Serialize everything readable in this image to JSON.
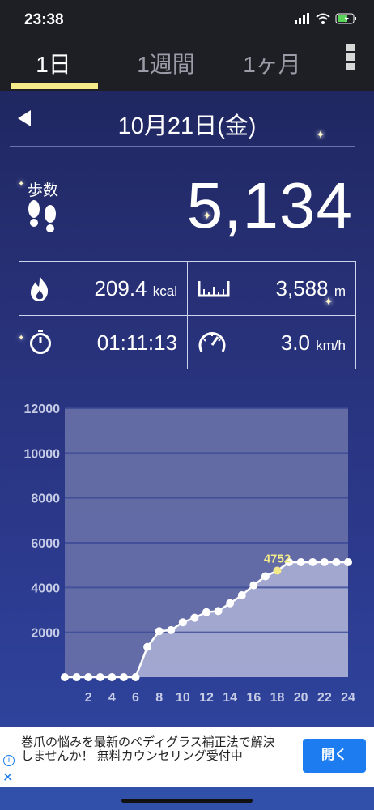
{
  "status": {
    "time": "23:38"
  },
  "tabs": [
    {
      "label": "1日",
      "active": true
    },
    {
      "label": "1週間",
      "active": false
    },
    {
      "label": "1ヶ月",
      "active": false
    }
  ],
  "date": {
    "label": "10月21日(金)"
  },
  "steps": {
    "label": "歩数",
    "value": "5,134"
  },
  "stats": {
    "calories": {
      "value": "209.4",
      "unit": "kcal"
    },
    "distance": {
      "value": "3,588",
      "unit": "m"
    },
    "time": {
      "value": "01:11:13",
      "unit": ""
    },
    "speed": {
      "value": "3.0",
      "unit": "km/h"
    }
  },
  "chart_data": {
    "type": "area",
    "title": "",
    "xlabel": "",
    "ylabel": "",
    "ylim": [
      0,
      12000
    ],
    "xlim": [
      0,
      24
    ],
    "yticks": [
      2000,
      4000,
      6000,
      8000,
      10000,
      12000
    ],
    "xticks": [
      2,
      4,
      6,
      8,
      10,
      12,
      14,
      16,
      18,
      20,
      22,
      24
    ],
    "highlight": {
      "x": 18,
      "label": "4752"
    },
    "series": [
      {
        "x": [
          0,
          1,
          2,
          3,
          4,
          5,
          6,
          7,
          8,
          9,
          10,
          11,
          12,
          13,
          14,
          15,
          16,
          17,
          18,
          19,
          20,
          21,
          22,
          23,
          24
        ],
        "values": [
          0,
          0,
          0,
          0,
          0,
          0,
          0,
          1350,
          2050,
          2100,
          2450,
          2650,
          2900,
          2950,
          3300,
          3650,
          4100,
          4500,
          4752,
          5134,
          5134,
          5134,
          5134,
          5134,
          5134
        ]
      }
    ],
    "colors": {
      "fill": "#a9aed5",
      "grid": "#3a4a96",
      "line": "#ffffff",
      "highlight": "#f2e98a"
    }
  },
  "ad": {
    "text": "巻爪の悩みを最新のペディグラス補正法で解決しませんか！ 無料カウンセリング受付中",
    "button": "開く"
  }
}
